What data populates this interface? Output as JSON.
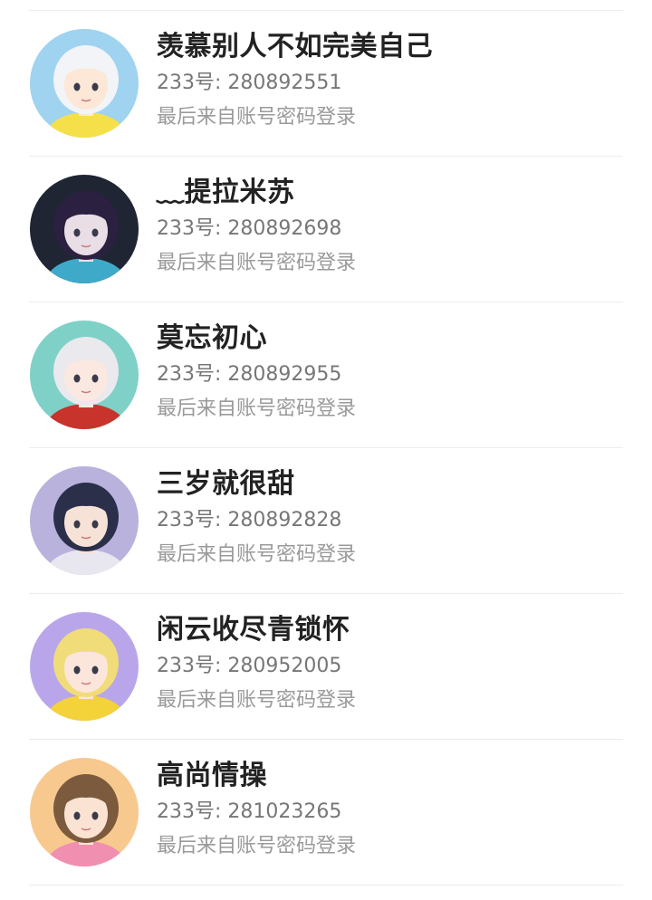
{
  "accounts": [
    {
      "nickname": "羡慕别人不如完美自己",
      "account_id": "233号: 280892551",
      "last_login": "最后来自账号密码登录",
      "avatar": {
        "bg": "#9fd3f0",
        "skin": "#fde7d6",
        "hair": "#f2f4f8",
        "accent": "#f6e04a"
      }
    },
    {
      "nickname": "﹏提拉米苏",
      "account_id": "233号: 280892698",
      "last_login": "最后来自账号密码登录",
      "avatar": {
        "bg": "#1f2533",
        "skin": "#e9dde6",
        "hair": "#2c2040",
        "accent": "#3fa9c9"
      }
    },
    {
      "nickname": "莫忘初心",
      "account_id": "233号: 280892955",
      "last_login": "最后来自账号密码登录",
      "avatar": {
        "bg": "#7fd1c8",
        "skin": "#fbe9e1",
        "hair": "#e9e9ee",
        "accent": "#c8342c"
      }
    },
    {
      "nickname": "三岁就很甜",
      "account_id": "233号: 280892828",
      "last_login": "最后来自账号密码登录",
      "avatar": {
        "bg": "#b8b2dd",
        "skin": "#f6e2d6",
        "hair": "#2b2f4a",
        "accent": "#e8e6ef"
      }
    },
    {
      "nickname": "闲云收尽青锁怀",
      "account_id": "233号: 280952005",
      "last_login": "最后来自账号密码登录",
      "avatar": {
        "bg": "#b9a6ea",
        "skin": "#fce6dc",
        "hair": "#f1dc7a",
        "accent": "#f4d23a"
      }
    },
    {
      "nickname": "高尚情操",
      "account_id": "233号: 281023265",
      "last_login": "最后来自账号密码登录",
      "avatar": {
        "bg": "#f7c98f",
        "skin": "#fbe3d4",
        "hair": "#7b5a3e",
        "accent": "#f08fb0"
      }
    }
  ]
}
